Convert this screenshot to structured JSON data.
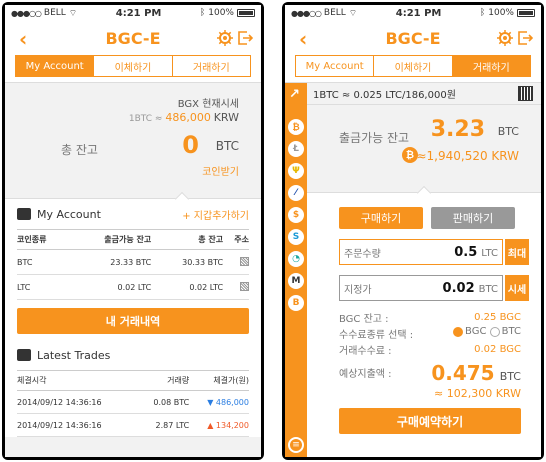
{
  "status": {
    "carrier": "BELL",
    "time": "4:21 PM",
    "battery": "100%"
  },
  "nav": {
    "title": "BGC-E"
  },
  "left": {
    "tabs": [
      "My Account",
      "이체하기",
      "거래하기"
    ],
    "price_label": "BGX 현재시세",
    "rate_prefix": "1BTC ≈",
    "rate_value": "486,000",
    "rate_unit": "KRW",
    "balance_label": "총 잔고",
    "balance_value": "0",
    "balance_unit": "BTC",
    "receive": "코인받기",
    "account_title": "My Account",
    "add_wallet": "+ 지갑추가하기",
    "account_headers": [
      "코인종류",
      "출금가능 잔고",
      "총 잔고",
      "주소"
    ],
    "account_rows": [
      [
        "BTC",
        "23.33 BTC",
        "30.33 BTC"
      ],
      [
        "LTC",
        "0.02 LTC",
        "0.02 LTC"
      ]
    ],
    "history_button": "내 거래내역",
    "trades_title": "Latest Trades",
    "trades_headers": [
      "체결시각",
      "거래량",
      "체결가(원)"
    ],
    "trades_rows": [
      {
        "time": "2014/09/12 14:36:16",
        "amount": "0.08 BTC",
        "arrow": "▼",
        "price": "486,000",
        "dir": "down"
      },
      {
        "time": "2014/09/12 14:36:16",
        "amount": "2.87 LTC",
        "arrow": "▲",
        "price": "134,200",
        "dir": "up"
      }
    ]
  },
  "right": {
    "tabs": [
      "My Account",
      "이체하기",
      "거래하기"
    ],
    "rate_bar": "1BTC ≈ 0.025 LTC/186,000원",
    "avail_label": "출금가능 잔고",
    "avail_value": "3.23",
    "avail_unit": "BTC",
    "avail_krw": "≈1,940,520 KRW",
    "buy": "구매하기",
    "sell": "판매하기",
    "qty_label": "주문수량",
    "qty_value": "0.5",
    "qty_unit": "LTC",
    "max_btn": "최대",
    "price_label": "지정가",
    "price_value": "0.02",
    "price_unit": "BTC",
    "market_btn": "시세",
    "bgc_label": "BGC 잔고 :",
    "bgc_value": "0.25 BGC",
    "fee_type_label": "수수료종류 선택 :",
    "fee_opt1": "BGC",
    "fee_opt2": "BTC",
    "fee_label": "거래수수료 :",
    "fee_value": "0.02 BGC",
    "expected_label": "예상지출액 :",
    "expected_value": "0.475",
    "expected_unit": "BTC",
    "expected_krw": "≈ 102,300 KRW",
    "reserve_btn": "구매예약하기",
    "coins": [
      {
        "glyph": "₿",
        "color": "#f7931e"
      },
      {
        "glyph": "Ł",
        "color": "#999999"
      },
      {
        "glyph": "Ψ",
        "color": "#e6b800"
      },
      {
        "glyph": "⁄",
        "color": "#1a4aa8"
      },
      {
        "glyph": "$",
        "color": "#f7931e"
      },
      {
        "glyph": "S",
        "color": "#1a9ad6"
      },
      {
        "glyph": "◔",
        "color": "#1aa8a0"
      },
      {
        "glyph": "M",
        "color": "#333333"
      },
      {
        "glyph": "B",
        "color": "#f7931e"
      }
    ]
  }
}
